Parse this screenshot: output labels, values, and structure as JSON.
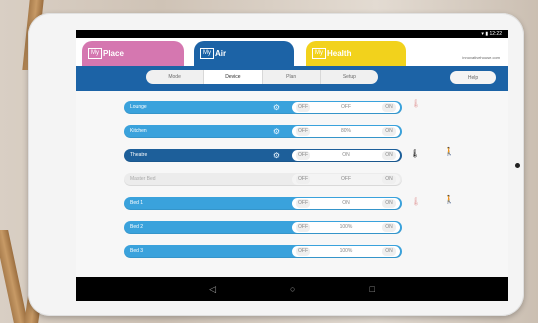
{
  "status_bar": {
    "time": "12:22"
  },
  "app_tabs": [
    {
      "box": "My",
      "label": "Place",
      "color": "#d577b0"
    },
    {
      "box": "My",
      "label": "Air",
      "color": "#1c63a6"
    },
    {
      "box": "My",
      "label": "Health",
      "color": "#f2d21c"
    }
  ],
  "website": "innovativehouse.com",
  "nav_tabs": [
    "Mode",
    "Device",
    "Plan",
    "Setup"
  ],
  "active_nav_tab": "Device",
  "help_label": "Help",
  "rows": [
    {
      "label": "Lounge",
      "value": "OFF",
      "state": "normal",
      "gear": true
    },
    {
      "label": "Kitchen",
      "value": "80%",
      "state": "normal",
      "gear": true
    },
    {
      "label": "Theatre",
      "value": "ON",
      "state": "selected",
      "gear": true
    },
    {
      "label": "Master Bed",
      "value": "OFF",
      "state": "disabled",
      "gear": false
    },
    {
      "label": "Bed 1",
      "value": "ON",
      "state": "normal",
      "gear": false
    },
    {
      "label": "Bed 2",
      "value": "100%",
      "state": "normal",
      "gear": false
    },
    {
      "label": "Bed 3",
      "value": "100%",
      "state": "normal",
      "gear": false
    }
  ],
  "controls": {
    "minus": "OFF",
    "plus": "ON"
  },
  "icons": {
    "wifi": "wifi-icon",
    "battery": "battery-icon",
    "thermometer": "thermometer-icon",
    "person": "person-icon",
    "back": "back-icon",
    "home": "home-icon",
    "recent": "recent-apps-icon"
  },
  "colors": {
    "primary": "#1c63a6",
    "pill": "#3aa2dc",
    "selected": "#1d5f9a",
    "place": "#d577b0",
    "health": "#f2d21c"
  }
}
